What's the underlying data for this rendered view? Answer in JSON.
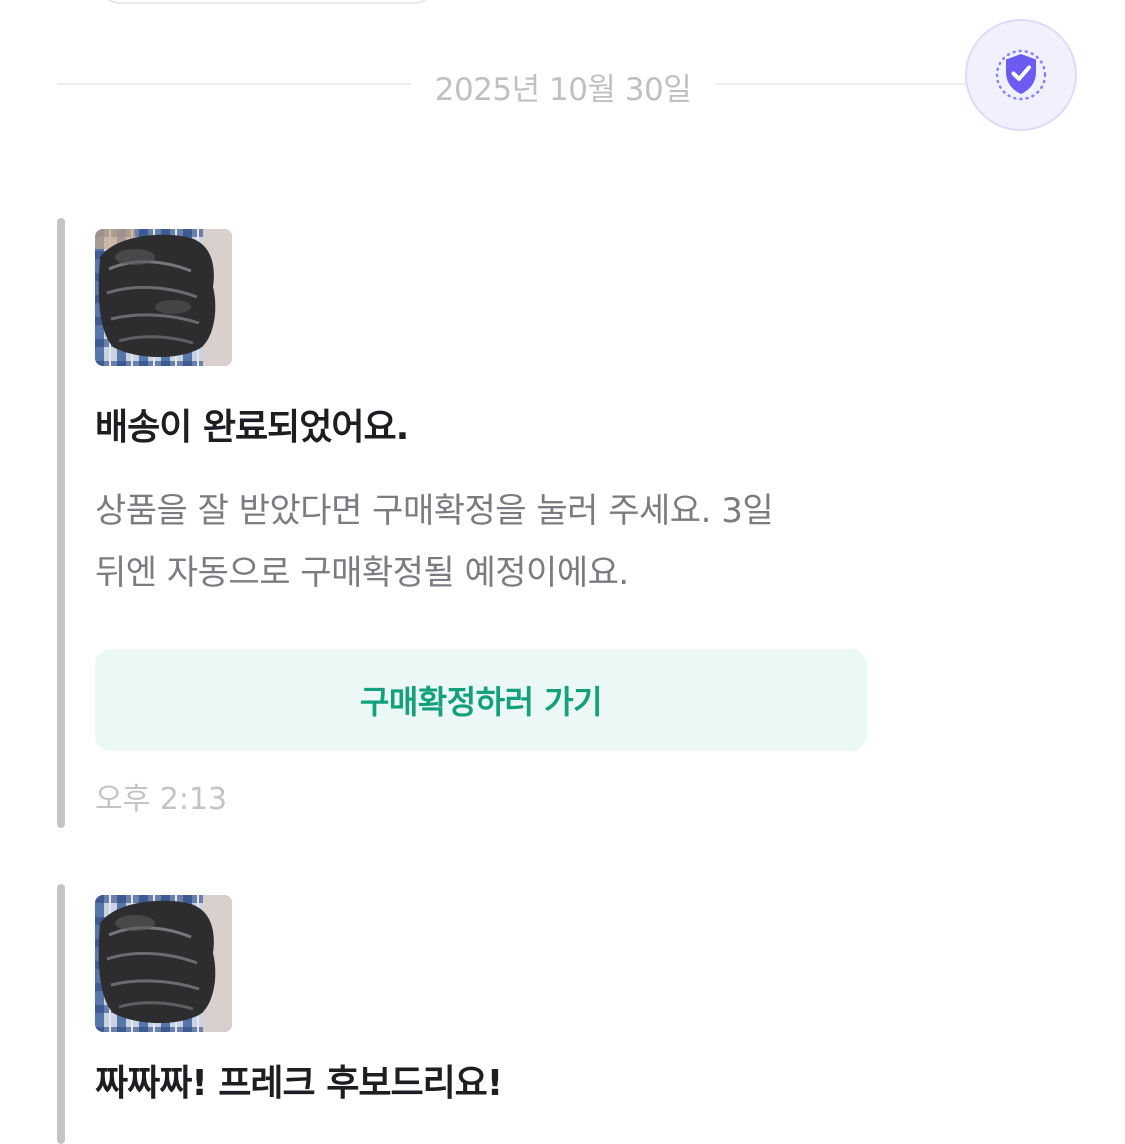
{
  "date_separator": "2025년 10월 30일",
  "safety_icon": "shield-check-icon",
  "messages": [
    {
      "thumbnail": "black-puffer-jacket-photo",
      "title": "배송이 완료되었어요.",
      "body_line1": "상품을 잘 받았다면 구매확정을 눌러 주세요. 3일",
      "body_line2": "뒤엔 자동으로 구매확정될 예정이에요.",
      "button_label": "구매확정하러 가기",
      "time": "오후 2:13"
    },
    {
      "thumbnail": "black-puffer-jacket-photo",
      "title": "짜짜짜! 프레크 후보드리요!"
    }
  ],
  "colors": {
    "accent": "#12a07d",
    "button_bg": "#ecf8f5",
    "shield": "#6b5bf0"
  }
}
